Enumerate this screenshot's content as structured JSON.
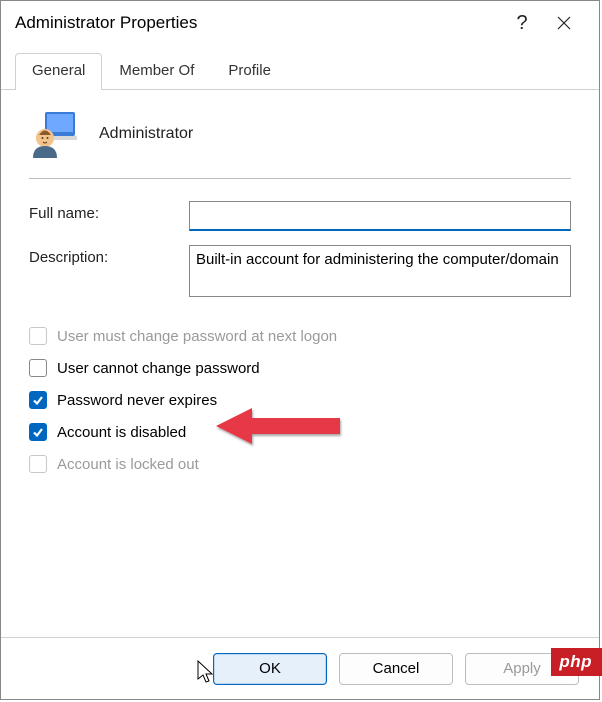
{
  "window": {
    "title": "Administrator Properties",
    "help_symbol": "?"
  },
  "tabs": [
    {
      "label": "General",
      "active": true
    },
    {
      "label": "Member Of",
      "active": false
    },
    {
      "label": "Profile",
      "active": false
    }
  ],
  "header": {
    "account_name": "Administrator"
  },
  "form": {
    "fullname_label": "Full name:",
    "fullname_value": "",
    "description_label": "Description:",
    "description_value": "Built-in account for administering the computer/domain"
  },
  "checks": [
    {
      "label": "User must change password at next logon",
      "checked": false,
      "disabled": true
    },
    {
      "label": "User cannot change password",
      "checked": false,
      "disabled": false
    },
    {
      "label": "Password never expires",
      "checked": true,
      "disabled": false
    },
    {
      "label": "Account is disabled",
      "checked": true,
      "disabled": false
    },
    {
      "label": "Account is locked out",
      "checked": false,
      "disabled": true
    }
  ],
  "buttons": {
    "ok": "OK",
    "cancel": "Cancel",
    "apply": "Apply"
  },
  "watermark": "php",
  "colors": {
    "accent": "#0067c0",
    "arrow": "#e63946",
    "watermark_bg": "#c81f27"
  }
}
